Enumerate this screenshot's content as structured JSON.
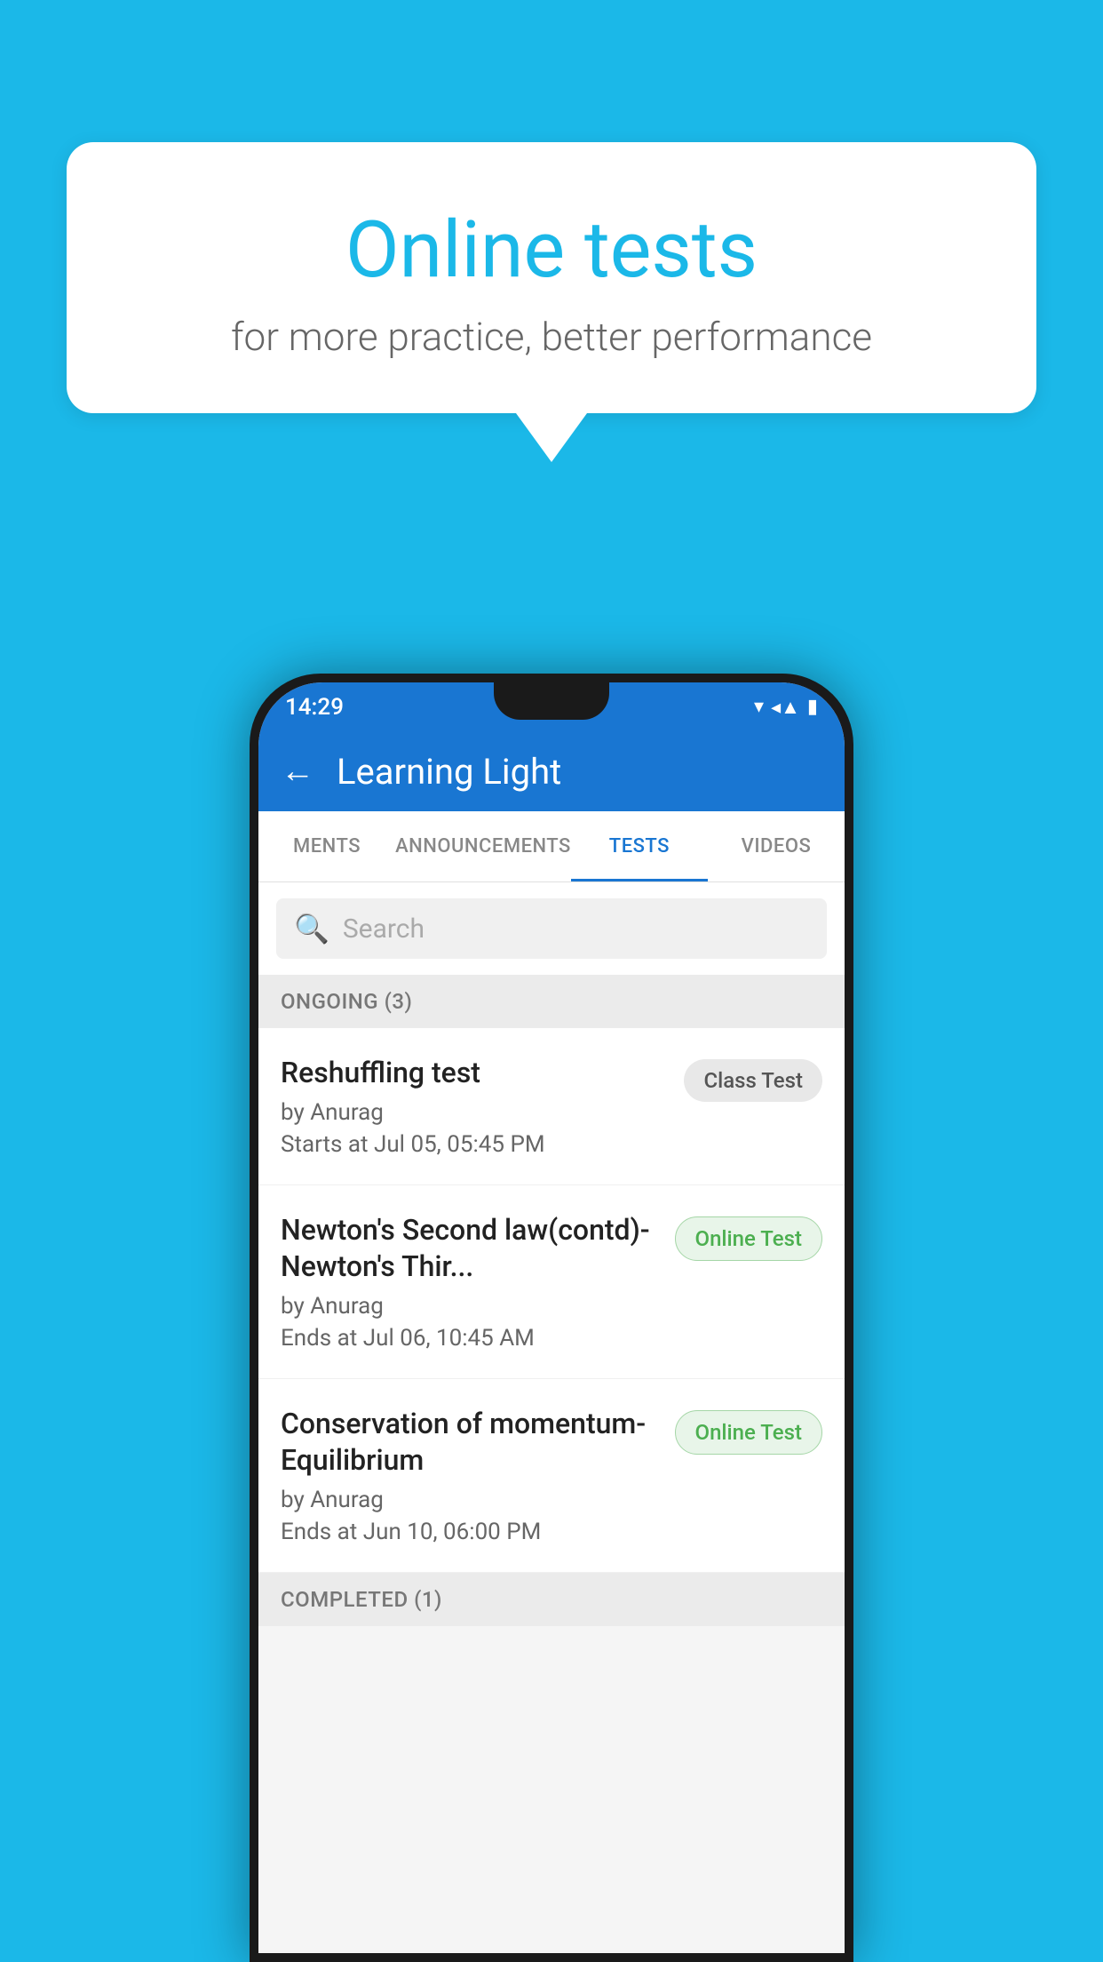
{
  "background_color": "#1bb8e8",
  "speech_bubble": {
    "title": "Online tests",
    "subtitle": "for more practice, better performance"
  },
  "phone": {
    "status_bar": {
      "time": "14:29",
      "icons": [
        "wifi",
        "signal",
        "battery"
      ]
    },
    "header": {
      "title": "Learning Light",
      "back_label": "←"
    },
    "tabs": [
      {
        "label": "MENTS",
        "active": false
      },
      {
        "label": "ANNOUNCEMENTS",
        "active": false
      },
      {
        "label": "TESTS",
        "active": true
      },
      {
        "label": "VIDEOS",
        "active": false
      }
    ],
    "search": {
      "placeholder": "Search"
    },
    "sections": [
      {
        "title": "ONGOING (3)",
        "tests": [
          {
            "name": "Reshuffling test",
            "author": "by Anurag",
            "time": "Starts at  Jul 05, 05:45 PM",
            "badge": "Class Test",
            "badge_type": "class"
          },
          {
            "name": "Newton's Second law(contd)-Newton's Thir...",
            "author": "by Anurag",
            "time": "Ends at  Jul 06, 10:45 AM",
            "badge": "Online Test",
            "badge_type": "online"
          },
          {
            "name": "Conservation of momentum-Equilibrium",
            "author": "by Anurag",
            "time": "Ends at  Jun 10, 06:00 PM",
            "badge": "Online Test",
            "badge_type": "online"
          }
        ]
      },
      {
        "title": "COMPLETED (1)",
        "tests": []
      }
    ]
  }
}
